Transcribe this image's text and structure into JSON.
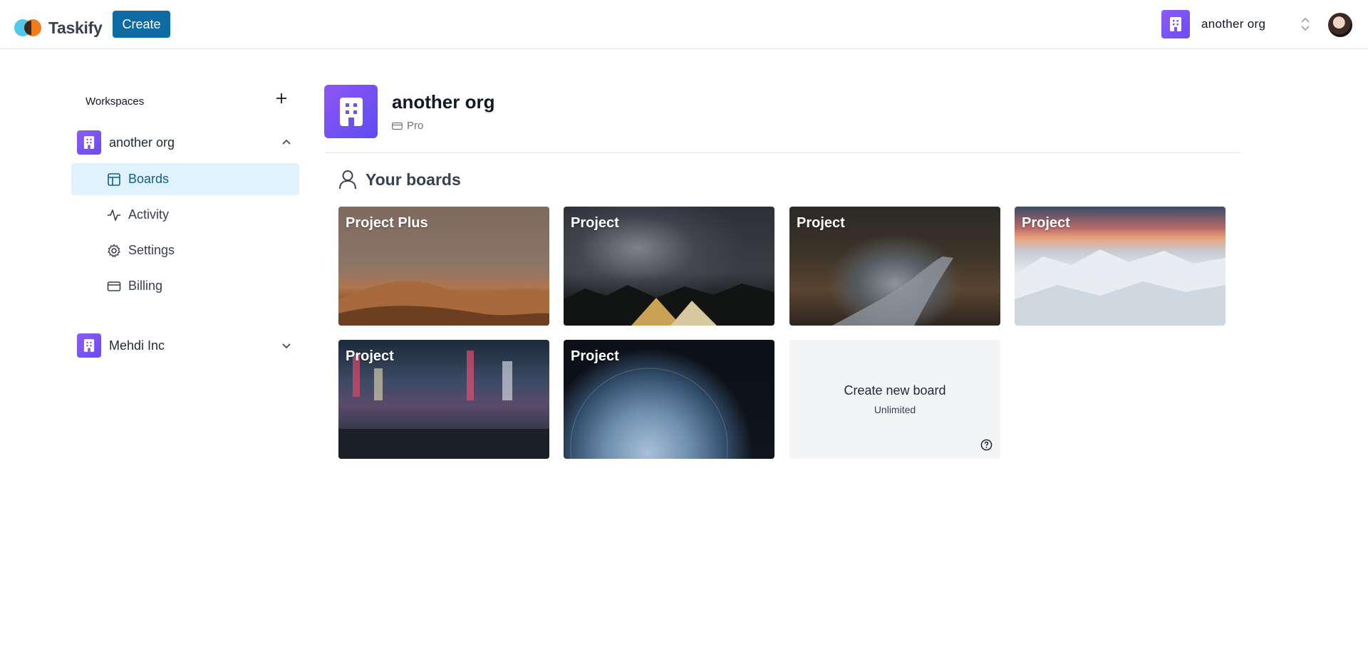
{
  "navbar": {
    "logo_text": "Taskify",
    "create_label": "Create",
    "current_org": "another org"
  },
  "sidebar": {
    "header": "Workspaces",
    "orgs": [
      {
        "name": "another org",
        "expanded": true,
        "items": [
          {
            "label": "Boards",
            "icon": "layout-icon",
            "active": true
          },
          {
            "label": "Activity",
            "icon": "activity-icon",
            "active": false
          },
          {
            "label": "Settings",
            "icon": "settings-icon",
            "active": false
          },
          {
            "label": "Billing",
            "icon": "credit-card-icon",
            "active": false
          }
        ]
      },
      {
        "name": "Mehdi Inc",
        "expanded": false
      }
    ]
  },
  "main": {
    "org_name": "another org",
    "plan": "Pro",
    "boards_heading": "Your boards",
    "boards": [
      {
        "title": "Project Plus"
      },
      {
        "title": "Project"
      },
      {
        "title": "Project"
      },
      {
        "title": "Project"
      },
      {
        "title": "Project"
      },
      {
        "title": "Project"
      }
    ],
    "create_board": {
      "title": "Create new board",
      "subtitle": "Unlimited"
    }
  },
  "colors": {
    "primary": "#0e6aa3",
    "active_nav_bg": "#e0f2fd",
    "org_gradient_start": "#8b5cf6",
    "org_gradient_end": "#6d4af2"
  }
}
